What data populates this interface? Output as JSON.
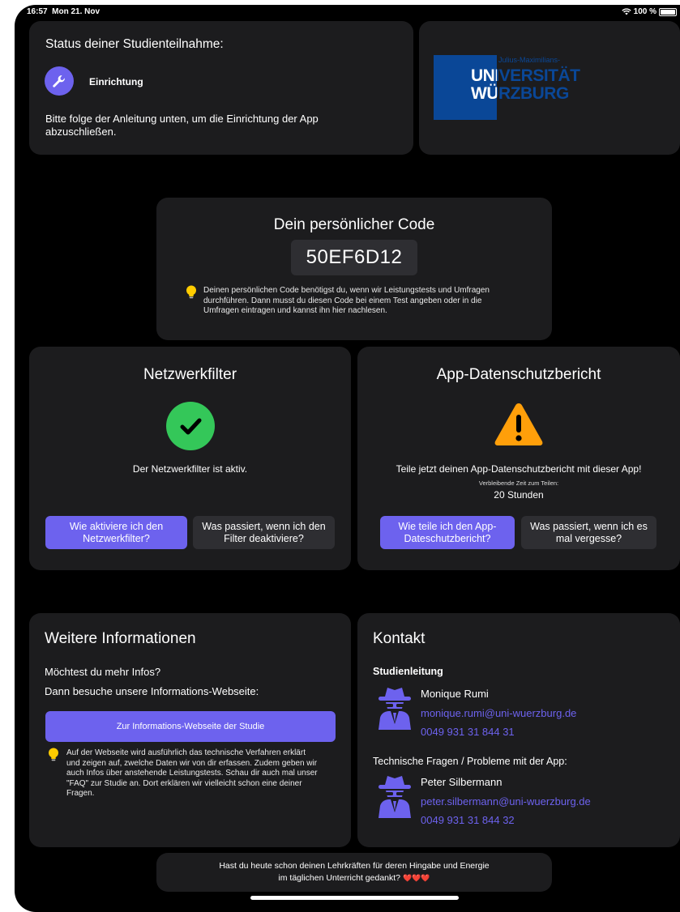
{
  "status_bar": {
    "time": "16:57",
    "date": "Mon 21. Nov",
    "battery": "100 %"
  },
  "status_card": {
    "title": "Status deiner Studienteilnahme:",
    "step_label": "Einrichtung",
    "step_icon": "wrench-icon",
    "description": "Bitte folge der Anleitung unten, um die Einrichtung der App abzuschließen."
  },
  "logo": {
    "line_small": "Julius-Maximilians-",
    "line1": "UNIVERSITÄT",
    "line2": "WÜRZBURG",
    "color": "#0a4797"
  },
  "code_card": {
    "title": "Dein persönlicher Code",
    "code": "50EF6D12",
    "tip": "Deinen persönlichen Code benötigst du, wenn wir Leistungstests und Umfragen durchführen. Dann musst du diesen Code bei einem Test angeben oder in die Umfragen eintragen und kannst ihn hier nachlesen."
  },
  "network_card": {
    "title": "Netzwerkfilter",
    "status_icon": "check-circle-icon",
    "status_color": "#34c759",
    "status_text": "Der Netzwerkfilter ist aktiv.",
    "button_primary": "Wie aktiviere ich den\nNetzwerkfilter?",
    "button_secondary": "Was passiert, wenn ich den\nFilter deaktiviere?"
  },
  "privacy_card": {
    "title": "App-Datenschutzbericht",
    "status_icon": "warning-triangle-icon",
    "status_color": "#ff9f0a",
    "status_text": "Teile jetzt deinen App-Datenschutzbericht mit dieser App!",
    "remaining_label": "Verbleibende Zeit zum Teilen:",
    "remaining_value": "20 Stunden",
    "button_primary": "Wie teile ich den App-\nDateschutzbericht?",
    "button_secondary": "Was passiert, wenn ich es\nmal vergesse?"
  },
  "info_card": {
    "title": "Weitere Informationen",
    "line1": "Möchtest du mehr Infos?",
    "line2": "Dann besuche unsere Informations-Webseite:",
    "button": "Zur Informations-Webseite der Studie",
    "tip": "Auf der Webseite wird ausführlich das technische Verfahren erklärt und zeigen auf, zwelche Daten wir von dir erfassen. Zudem geben wir auch Infos über anstehende Leistungstests. Schau dir auch mal unser \"FAQ\" zur Studie an. Dort erklären wir vielleicht schon eine deiner Fragen."
  },
  "contact_card": {
    "title": "Kontakt",
    "section1": "Studienleitung",
    "person1": {
      "name": "Monique Rumi",
      "email": "monique.rumi@uni-wuerzburg.de",
      "phone": "0049 931 31 844 31"
    },
    "section2": "Technische Fragen / Probleme mit der App:",
    "person2": {
      "name": "Peter Silbermann",
      "email": "peter.silbermann@uni-wuerzburg.de",
      "phone": "0049 931 31 844 32"
    },
    "avatar_icon": "spy-icon",
    "link_color": "#6d62ee"
  },
  "footer_card": {
    "line1": "Hast du heute schon deinen Lehrkräften für deren Hingabe und Energie",
    "line2": "im täglichen Unterricht gedankt?",
    "hearts": "❤️❤️❤️"
  }
}
